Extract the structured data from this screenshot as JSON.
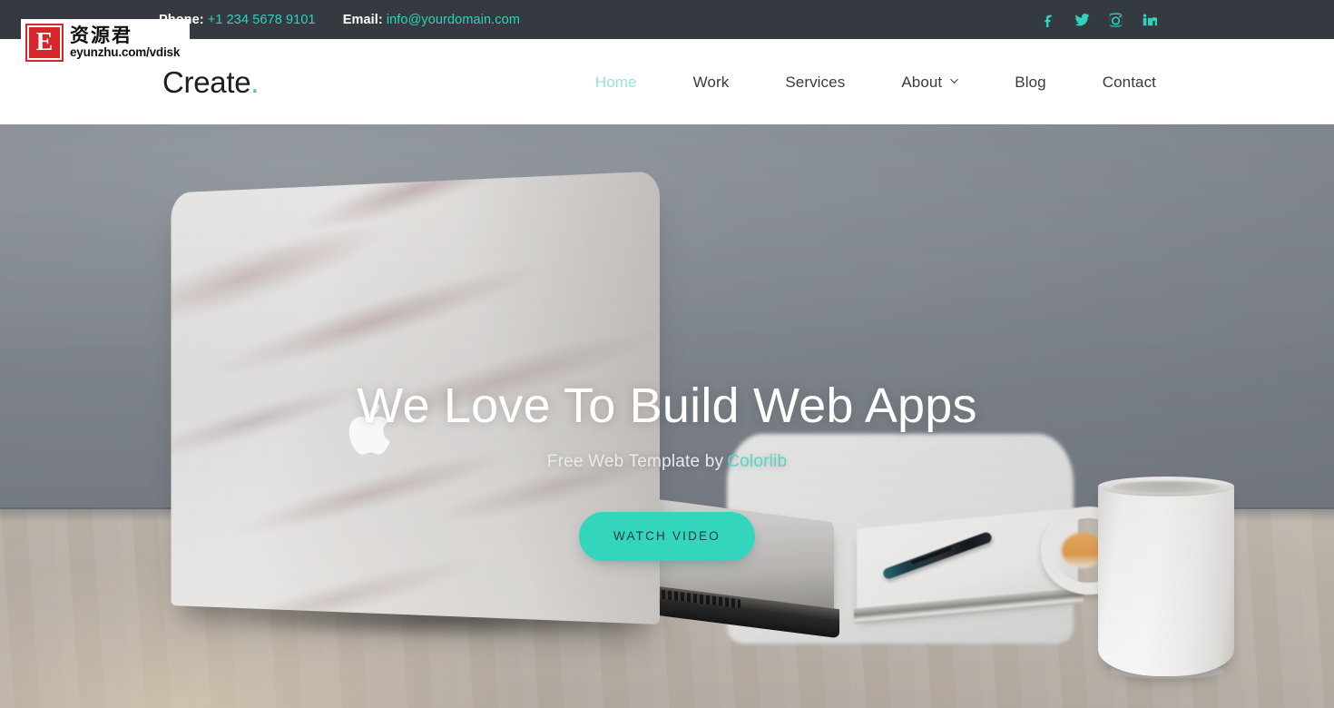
{
  "topbar": {
    "phone_label": "Phone:",
    "phone_value": "+1 234 5678 9101",
    "email_label": "Email:",
    "email_value": "info@yourdomain.com",
    "social": [
      {
        "name": "facebook-icon",
        "title": "Facebook"
      },
      {
        "name": "twitter-icon",
        "title": "Twitter"
      },
      {
        "name": "instagram-icon",
        "title": "Instagram"
      },
      {
        "name": "linkedin-icon",
        "title": "LinkedIn"
      }
    ],
    "bg_color": "#343a40",
    "accent_color": "#2fd2bb"
  },
  "header": {
    "brand": "Create",
    "brand_dot": ".",
    "nav": [
      {
        "label": "Home",
        "active": true,
        "has_dropdown": false
      },
      {
        "label": "Work",
        "active": false,
        "has_dropdown": false
      },
      {
        "label": "Services",
        "active": false,
        "has_dropdown": false
      },
      {
        "label": "About",
        "active": false,
        "has_dropdown": true
      },
      {
        "label": "Blog",
        "active": false,
        "has_dropdown": false
      },
      {
        "label": "Contact",
        "active": false,
        "has_dropdown": false
      }
    ]
  },
  "hero": {
    "title": "We Love To Build Web Apps",
    "subtitle_prefix": "Free Web Template by",
    "subtitle_link": "Colorlib",
    "button_label": "WATCH VIDEO",
    "button_color": "#33d6bd",
    "scene_description": "Marble-patterned MacBook on a light wood desk with a white chair, notepad with pen and a white coffee mug against a gray wall",
    "apple_logo": "apple-logo-icon"
  },
  "watermark": {
    "badge_letter": "E",
    "cn_text": "资源君",
    "url_text": "eyunzhu.com/vdisk",
    "badge_color": "#d7262a"
  }
}
